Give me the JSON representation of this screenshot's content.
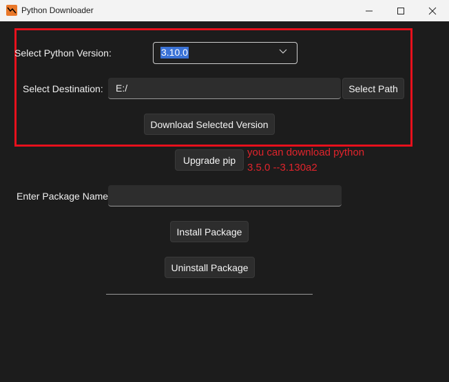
{
  "window": {
    "title": "Python Downloader",
    "controls": [
      "minimize-icon",
      "maximize-icon",
      "close-icon"
    ]
  },
  "form": {
    "version_label": "Select Python Version:",
    "version_value": "3.10.0",
    "destination_label": "Select Destination:",
    "destination_value": "E:/",
    "select_path_button": "Select Path",
    "download_button": "Download Selected Version",
    "upgrade_pip_button": "Upgrade pip",
    "package_label": "Enter Package Name:",
    "package_value": "",
    "install_button": "Install Package",
    "uninstall_button": "Uninstall Package"
  },
  "annotation": {
    "line1": "you can download python",
    "line2": "3.5.0 --3.130a2"
  },
  "colors": {
    "background": "#1c1c1c",
    "highlight": "#e8101c",
    "annotation": "#e1242c",
    "selection": "#3a72d6",
    "app_icon": "#e9782a"
  }
}
